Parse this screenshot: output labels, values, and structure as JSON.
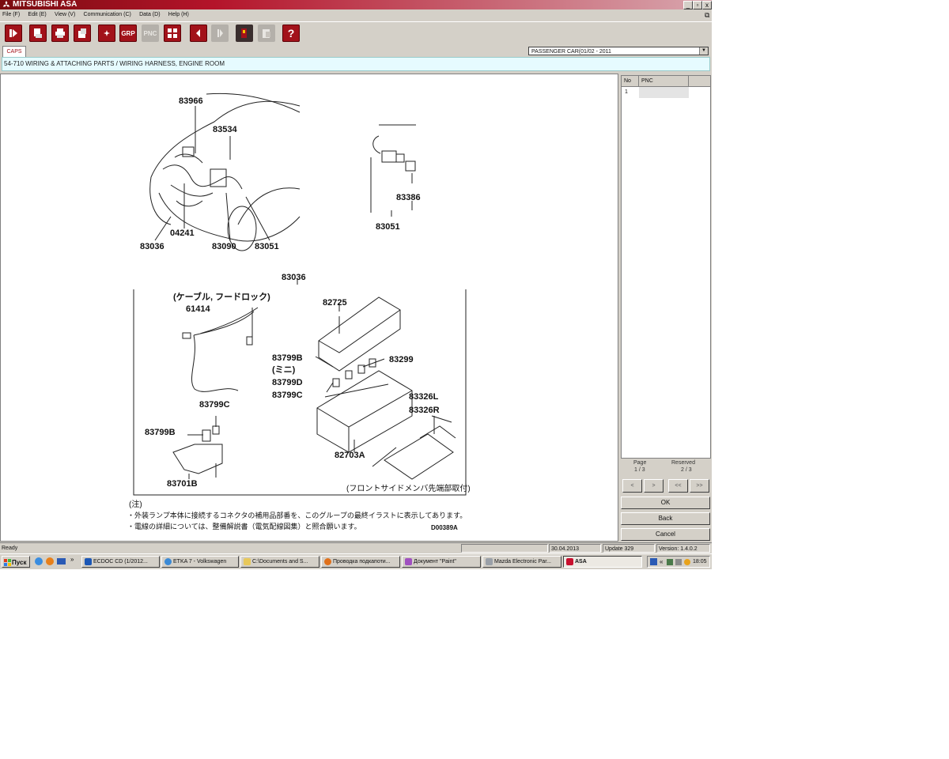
{
  "window": {
    "title": "MITSUBISHI ASA",
    "controls": [
      "_",
      "▫",
      "x"
    ]
  },
  "menu": [
    "File (F)",
    "Edit (E)",
    "View (V)",
    "Communication (C)",
    "Data (D)",
    "Help (H)"
  ],
  "toolbar": {
    "grp_label": "GRP",
    "pnc_label": "PNC",
    "help_label": "?"
  },
  "tab": {
    "label": "CAPS"
  },
  "combo": {
    "value": "PASSENGER CAR(01/02 - 2011"
  },
  "breadcrumb": "54-710  WIRING & ATTACHING PARTS / WIRING HARNESS, ENGINE ROOM",
  "diagram": {
    "top_labels": [
      "83966",
      "83534",
      "04241",
      "83036",
      "83090",
      "83051"
    ],
    "connector_labels": [
      "83386",
      "83051"
    ],
    "group_label": "83036",
    "box_labels": [
      "(ケーブル, フードロック)",
      "61414",
      "82725",
      "83799B",
      "(ミニ)",
      "83799D",
      "83799C",
      "83299",
      "83326L",
      "83326R",
      "83799C",
      "83799B",
      "82703A",
      "83701B"
    ],
    "box_caption": "(フロントサイドメンバ先端部取付)",
    "note_title": "(注)",
    "notes": [
      "・外装ランプ本体に接続するコネクタの補用品部番を、このグループの最終イラストに表示してあります。",
      "・電線の詳細については、整備解説書（電気配線図集）と照合願います。"
    ],
    "drawing_code": "D00389A"
  },
  "grid": {
    "headers": [
      "No",
      "PNC"
    ],
    "rows": [
      {
        "no": "1",
        "pnc": ""
      }
    ]
  },
  "pageinfo": {
    "page_label": "Page",
    "page_value": "1 / 3",
    "reserved_label": "Reserved",
    "reserved_value": "2 / 3"
  },
  "nav": [
    "<",
    ">",
    "<<",
    ">>"
  ],
  "buttons": {
    "ok": "OK",
    "back": "Back",
    "cancel": "Cancel"
  },
  "status": {
    "ready": "Ready",
    "date": "30.04.2013",
    "update": "Update 329",
    "version": "Version: 1.4.0.2"
  },
  "taskbar": {
    "start": "Пуск",
    "tasks": [
      "ECDOC CD (1/2012...",
      "ETKA 7 - Volkswagen",
      "C:\\Documents and S...",
      "Проводка подкапоти...",
      "Документ \"Paint\"",
      "Mazda Electronic Par...",
      "ASA"
    ],
    "clock": "18:05"
  },
  "colors": {
    "brand_red": "#a2121a",
    "breadcrumb_bg": "#e6fbff",
    "window_gray": "#d4d0c8"
  }
}
